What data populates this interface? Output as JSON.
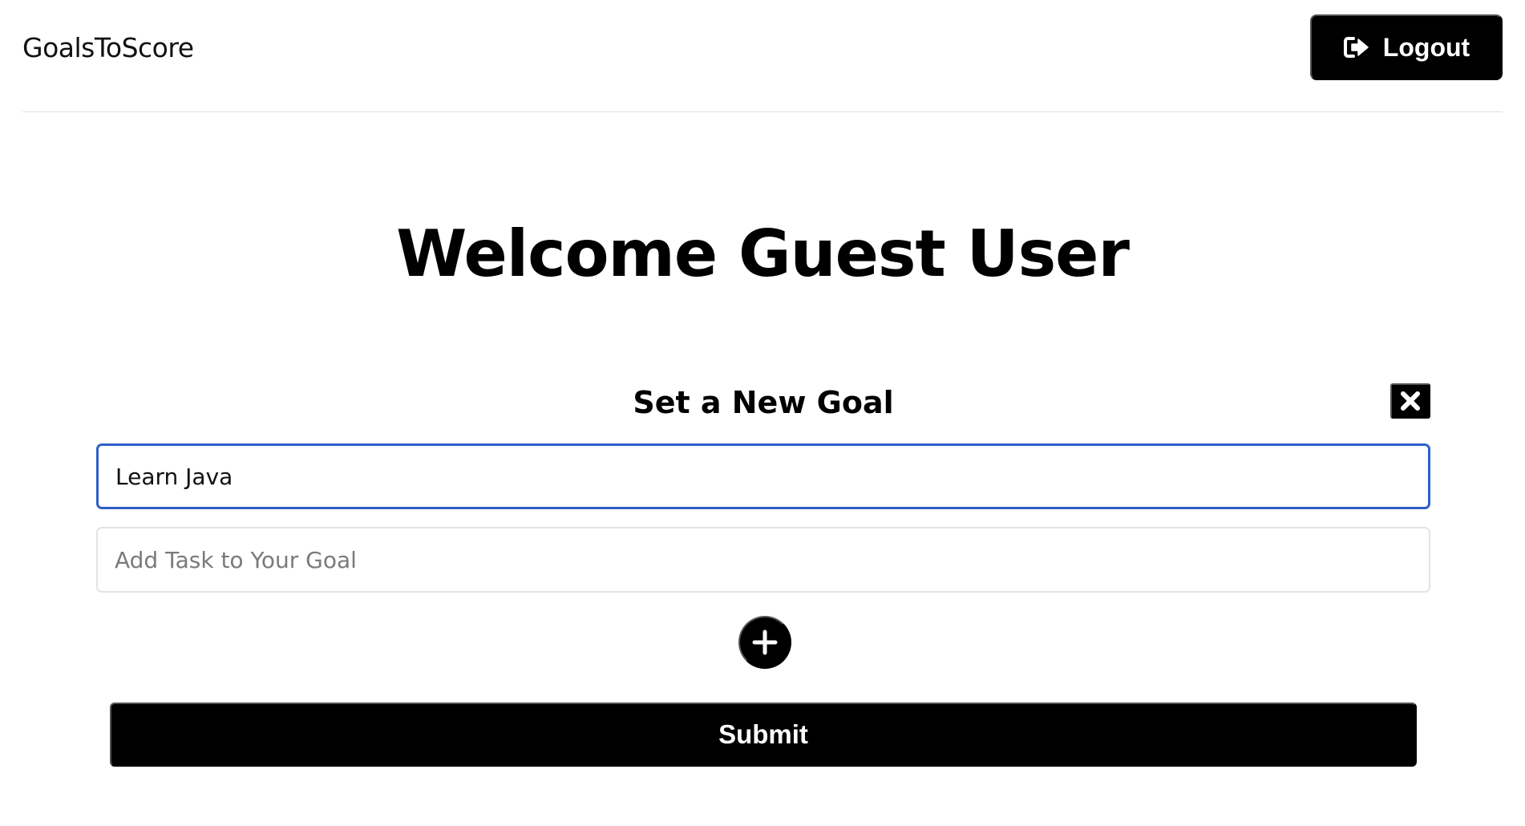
{
  "header": {
    "brand": "GoalsToScore",
    "logout_label": "Logout",
    "logout_icon": "sign-out-icon"
  },
  "welcome": {
    "heading": "Welcome Guest User"
  },
  "goal_form": {
    "title": "Set a New Goal",
    "close_icon": "close-icon",
    "goal_input": {
      "value": "Learn Java",
      "placeholder": ""
    },
    "task_input": {
      "value": "",
      "placeholder": "Add Task to Your Goal"
    },
    "add_icon": "plus-icon",
    "submit_label": "Submit"
  },
  "colors": {
    "primary": "#000000",
    "focus_border": "#2d5fc8",
    "input_border": "#e3e3e3",
    "placeholder": "#7a7a7a",
    "background": "#ffffff"
  }
}
